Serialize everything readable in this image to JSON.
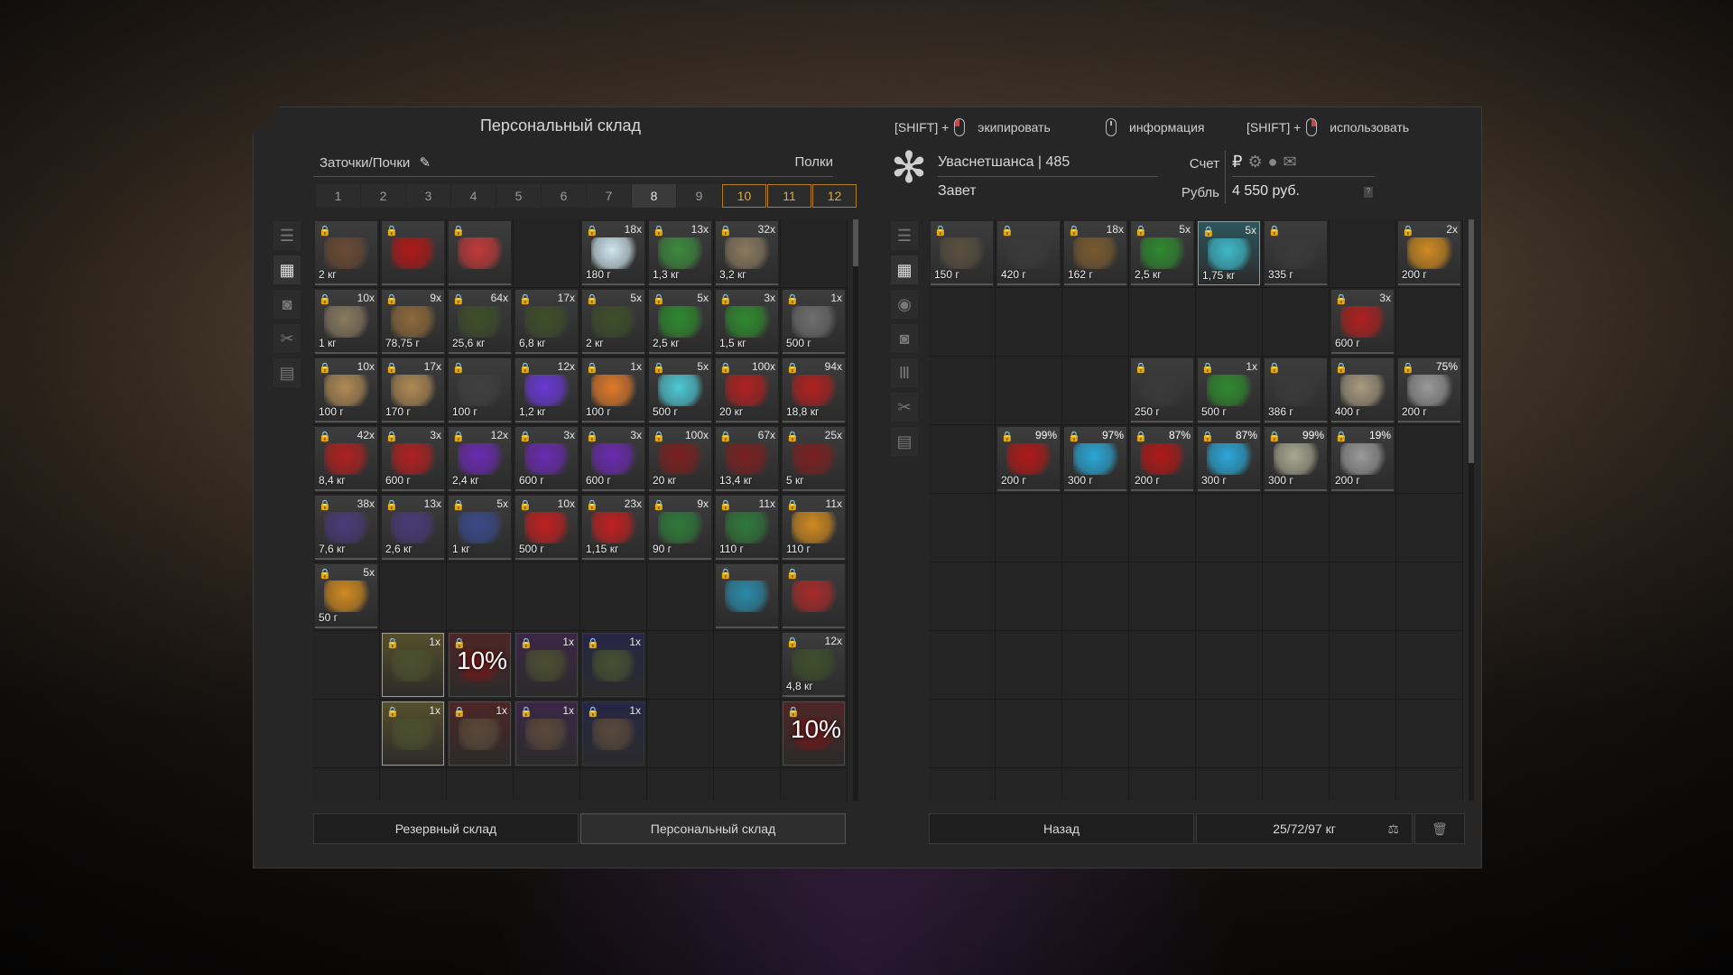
{
  "left": {
    "title": "Персональный склад",
    "subtitle": "Заточки/Почки",
    "shelves_label": "Полки",
    "tabs": [
      "1",
      "2",
      "3",
      "4",
      "5",
      "6",
      "7",
      "8",
      "9",
      "10",
      "11",
      "12"
    ],
    "selected_tab": "8",
    "gold_tabs": [
      "10",
      "11",
      "12"
    ],
    "buttons": {
      "reserve": "Резервный склад",
      "personal": "Персональный склад"
    }
  },
  "hints": {
    "equip_key": "[SHIFT] +",
    "equip_label": "экипировать",
    "info_label": "информация",
    "use_key": "[SHIFT] +",
    "use_label": "использовать"
  },
  "right": {
    "player": "Уваснетшанса | 485",
    "faction": "Завет",
    "account_label": "Счет",
    "currency_label": "Рубль",
    "currency_value": "4 550 руб.",
    "back_button": "Назад",
    "weight": "25/72/97 кг"
  },
  "left_items": [
    {
      "c": "2 кг",
      "n": "",
      "col": "#6b4a35"
    },
    {
      "c": "",
      "n": "",
      "col": "#b01818"
    },
    {
      "c": "",
      "n": "",
      "col": "#c23a3a"
    },
    null,
    {
      "c": "180 г",
      "n": "18x",
      "col": "#cfe7ef"
    },
    {
      "c": "1,3 кг",
      "n": "13x",
      "col": "#3d8a3d"
    },
    {
      "c": "3,2 кг",
      "n": "32x",
      "col": "#8a7a60"
    },
    null,
    {
      "c": "1 кг",
      "n": "10x",
      "col": "#8a7a60"
    },
    {
      "c": "78,75 г",
      "n": "9x",
      "col": "#8d6a3b"
    },
    {
      "c": "25,6 кг",
      "n": "64x",
      "col": "#3e4f2a"
    },
    {
      "c": "6,8 кг",
      "n": "17x",
      "col": "#3e4f2a"
    },
    {
      "c": "2 кг",
      "n": "5x",
      "col": "#3e4f2a"
    },
    {
      "c": "2,5 кг",
      "n": "5x",
      "col": "#2f8a2f"
    },
    {
      "c": "1,5 кг",
      "n": "3x",
      "col": "#2f8a2f"
    },
    {
      "c": "500 г",
      "n": "1x",
      "col": "#6f6f6f"
    },
    {
      "c": "100 г",
      "n": "10x",
      "col": "#b08a55"
    },
    {
      "c": "170 г",
      "n": "17x",
      "col": "#b08a55"
    },
    {
      "c": "100 г",
      "n": "",
      "col": "#404040"
    },
    {
      "c": "1,2 кг",
      "n": "12x",
      "col": "#6a38d6"
    },
    {
      "c": "100 г",
      "n": "1x",
      "col": "#e07a2a"
    },
    {
      "c": "500 г",
      "n": "5x",
      "col": "#4fc9d6"
    },
    {
      "c": "20 кг",
      "n": "100x",
      "col": "#b02020"
    },
    {
      "c": "18,8 кг",
      "n": "94x",
      "col": "#b02020"
    },
    {
      "c": "8,4 кг",
      "n": "42x",
      "col": "#b02020"
    },
    {
      "c": "600 г",
      "n": "3x",
      "col": "#b02020"
    },
    {
      "c": "2,4 кг",
      "n": "12x",
      "col": "#6a2ab0"
    },
    {
      "c": "600 г",
      "n": "3x",
      "col": "#6a2ab0"
    },
    {
      "c": "600 г",
      "n": "3x",
      "col": "#6a2ab0"
    },
    {
      "c": "20 кг",
      "n": "100x",
      "col": "#7a2020"
    },
    {
      "c": "13,4 кг",
      "n": "67x",
      "col": "#7a2020"
    },
    {
      "c": "5 кг",
      "n": "25x",
      "col": "#7a2020"
    },
    {
      "c": "7,6 кг",
      "n": "38x",
      "col": "#4a3a7a"
    },
    {
      "c": "2,6 кг",
      "n": "13x",
      "col": "#4a3a7a"
    },
    {
      "c": "1 кг",
      "n": "5x",
      "col": "#3a4a8a"
    },
    {
      "c": "500 г",
      "n": "10x",
      "col": "#c02020"
    },
    {
      "c": "1,15 кг",
      "n": "23x",
      "col": "#c02020"
    },
    {
      "c": "90 г",
      "n": "9x",
      "col": "#2f7a3a"
    },
    {
      "c": "110 г",
      "n": "11x",
      "col": "#2f7a3a"
    },
    {
      "c": "110 г",
      "n": "11x",
      "col": "#d08a20"
    },
    {
      "c": "50 г",
      "n": "5x",
      "col": "#d08a20"
    },
    null,
    null,
    null,
    null,
    null,
    {
      "c": "",
      "n": "",
      "col": "#2a8aa8"
    },
    {
      "c": "",
      "n": "",
      "col": "#a82a2a"
    },
    null,
    {
      "c": "",
      "n": "1x",
      "col": "#4a5030",
      "frame": "#b8a53a"
    },
    {
      "c": "",
      "n": "",
      "col": "#6a1a1a",
      "frame": "#a02a2a",
      "big": "10%"
    },
    {
      "c": "",
      "n": "1x",
      "col": "#4a5030",
      "frame": "#6a2a8a"
    },
    {
      "c": "",
      "n": "1x",
      "col": "#4a5030",
      "frame": "#2a2a8a"
    },
    null,
    null,
    {
      "c": "4,8 кг",
      "n": "12x",
      "col": "#3e4f2a"
    },
    null,
    {
      "c": "",
      "n": "1x",
      "col": "#4a5030",
      "frame": "#b8a53a"
    },
    {
      "c": "",
      "n": "1x",
      "col": "#5a4a3a",
      "frame": "#a02a2a"
    },
    {
      "c": "",
      "n": "1x",
      "col": "#5a4a3a",
      "frame": "#6a2a8a"
    },
    {
      "c": "",
      "n": "1x",
      "col": "#5a4a3a",
      "frame": "#2a2a8a"
    },
    null,
    null,
    {
      "c": "",
      "n": "",
      "col": "#6a1a1a",
      "frame": "#a02a2a",
      "big": "10%"
    }
  ],
  "right_items": [
    {
      "c": "150 г",
      "n": "",
      "col": "#5a5040"
    },
    {
      "c": "420 г",
      "n": "",
      "col": "#3a3a3a"
    },
    {
      "c": "162 г",
      "n": "18x",
      "col": "#7a5a30"
    },
    {
      "c": "2,5 кг",
      "n": "5x",
      "col": "#2f8a2f"
    },
    {
      "c": "1,75 кг",
      "n": "5x",
      "col": "#3fb8c8",
      "frame": "#3fb8c8"
    },
    {
      "c": "335 г",
      "n": "",
      "col": "#3a3a3a"
    },
    null,
    {
      "c": "200 г",
      "n": "2x",
      "col": "#d08a20"
    },
    null,
    null,
    null,
    null,
    null,
    null,
    {
      "c": "600 г",
      "n": "3x",
      "col": "#b02020"
    },
    null,
    null,
    null,
    null,
    {
      "c": "250 г",
      "n": "",
      "col": "#3a3a3a"
    },
    {
      "c": "500 г",
      "n": "1x",
      "col": "#2f8a2f"
    },
    {
      "c": "386 г",
      "n": "",
      "col": "#3a3a3a"
    },
    {
      "c": "400 г",
      "n": "",
      "col": "#a89a80"
    },
    {
      "c": "200 г",
      "n": "",
      "col": "#9a9a9a",
      "pct": "75%"
    },
    null,
    {
      "c": "200 г",
      "n": "",
      "col": "#b01818",
      "pct": "99%"
    },
    {
      "c": "300 г",
      "n": "",
      "col": "#2aa8d8",
      "pct": "97%"
    },
    {
      "c": "200 г",
      "n": "",
      "col": "#b01818",
      "pct": "87%"
    },
    {
      "c": "300 г",
      "n": "",
      "col": "#2aa8d8",
      "pct": "87%"
    },
    {
      "c": "300 г",
      "n": "",
      "col": "#a8a890",
      "pct": "99%"
    },
    {
      "c": "200 г",
      "n": "",
      "col": "#9a9a9a",
      "pct": "19%"
    },
    null
  ]
}
